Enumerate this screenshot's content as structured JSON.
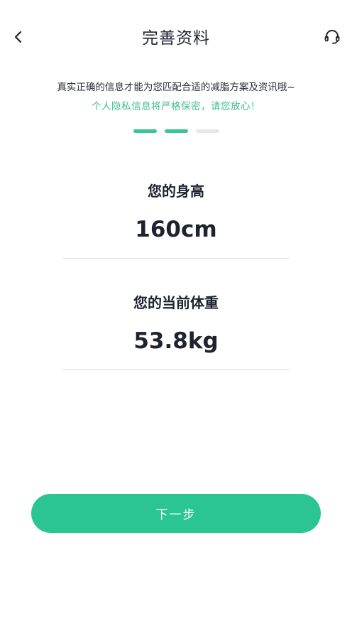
{
  "header": {
    "title": "完善资料",
    "back_icon": "chevron-left-icon",
    "service_icon": "headset-icon"
  },
  "notice": {
    "main": "真实正确的信息才能为您匹配合适的减脂方案及资讯哦~",
    "privacy": "个人隐私信息将严格保密，请您放心！"
  },
  "progress": {
    "total_steps": 3,
    "completed_steps": 2
  },
  "height_field": {
    "label": "您的身高",
    "value": "160cm"
  },
  "weight_field": {
    "label": "您的当前体重",
    "value": "53.8kg"
  },
  "actions": {
    "next_label": "下一步"
  },
  "colors": {
    "accent": "#2bc594",
    "privacy_text": "#3fbf8c",
    "step_inactive": "#e6e8ec"
  }
}
